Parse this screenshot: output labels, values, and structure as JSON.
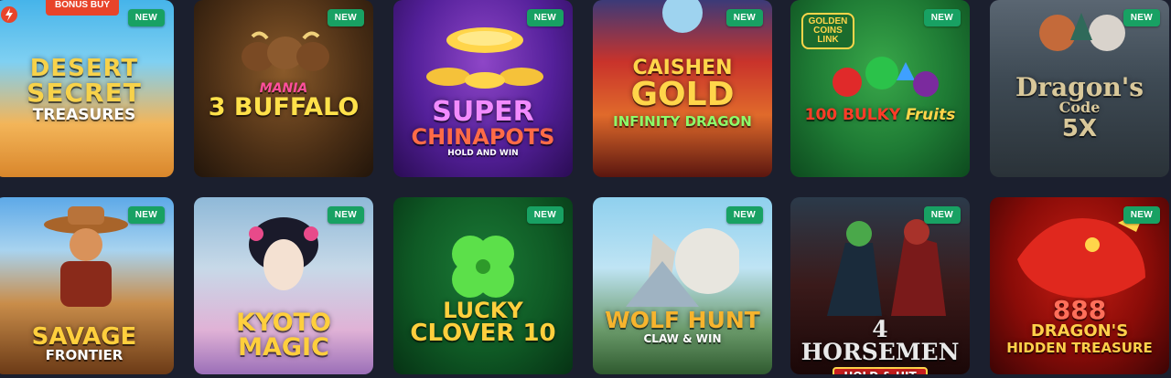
{
  "badge_label": "NEW",
  "ribbon_label": "BONUS BUY",
  "games": [
    {
      "line1": "DESERT",
      "line2": "SECRET",
      "line3": "TREASURES",
      "colors": {
        "bg1": "#f6b54e",
        "bg2": "#3db6e8",
        "text": "#f7d24a"
      }
    },
    {
      "line1": "MANIA",
      "line2": "3 BUFFALO",
      "line3": "",
      "colors": {
        "bg1": "#5c3b1d",
        "bg2": "#2d1a0d",
        "text": "#ffe14a"
      }
    },
    {
      "line1": "SUPER",
      "line2": "CHINAPOTS",
      "line3": "HOLD AND WIN",
      "colors": {
        "bg1": "#6a2d9e",
        "bg2": "#2d0e59",
        "text": "#ff6b47"
      }
    },
    {
      "line1": "CAISHEN",
      "line2": "GOLD",
      "line3": "INFINITY DRAGON",
      "colors": {
        "bg1": "#c9332b",
        "bg2": "#3d0f0f",
        "text": "#ffd54a"
      }
    },
    {
      "line1": "GOLDEN COINS LINK",
      "line2": "100 BULKY",
      "line3": "Fruits",
      "colors": {
        "bg1": "#2b8a3e",
        "bg2": "#0d3b1b",
        "text": "#ff3c28"
      }
    },
    {
      "line1": "Dragon's",
      "line2": "Code",
      "line3": "5X",
      "colors": {
        "bg1": "#54606a",
        "bg2": "#1f2a33",
        "text": "#d9c89a"
      }
    },
    {
      "line1": "SAVAGE",
      "line2": "FRONTIER",
      "line3": "",
      "colors": {
        "bg1": "#5da9e8",
        "bg2": "#8a4b1f",
        "text": "#ffcf3d"
      }
    },
    {
      "line1": "KYOTO",
      "line2": "MAGIC",
      "line3": "",
      "colors": {
        "bg1": "#8fb9d8",
        "bg2": "#d19ac8",
        "text": "#ffcf3d"
      }
    },
    {
      "line1": "LUCKY",
      "line2": "CLOVER 10",
      "line3": "",
      "colors": {
        "bg1": "#0f5a25",
        "bg2": "#083515",
        "text": "#ffcf3d"
      }
    },
    {
      "line1": "WOLF HUNT",
      "line2": "CLAW & WIN",
      "line3": "",
      "colors": {
        "bg1": "#8fd0ee",
        "bg2": "#3b6a3a",
        "text": "#f6b42e"
      }
    },
    {
      "line1": "4 HORSEMEN",
      "line2": "HOLD & HIT",
      "line3": "",
      "colors": {
        "bg1": "#2b3a4a",
        "bg2": "#1a0707",
        "text": "#e9e9e9"
      }
    },
    {
      "line1": "888",
      "line2": "DRAGON'S",
      "line3": "HIDDEN TREASURE",
      "colors": {
        "bg1": "#b1130e",
        "bg2": "#3c0404",
        "text": "#ffd04a"
      }
    }
  ]
}
